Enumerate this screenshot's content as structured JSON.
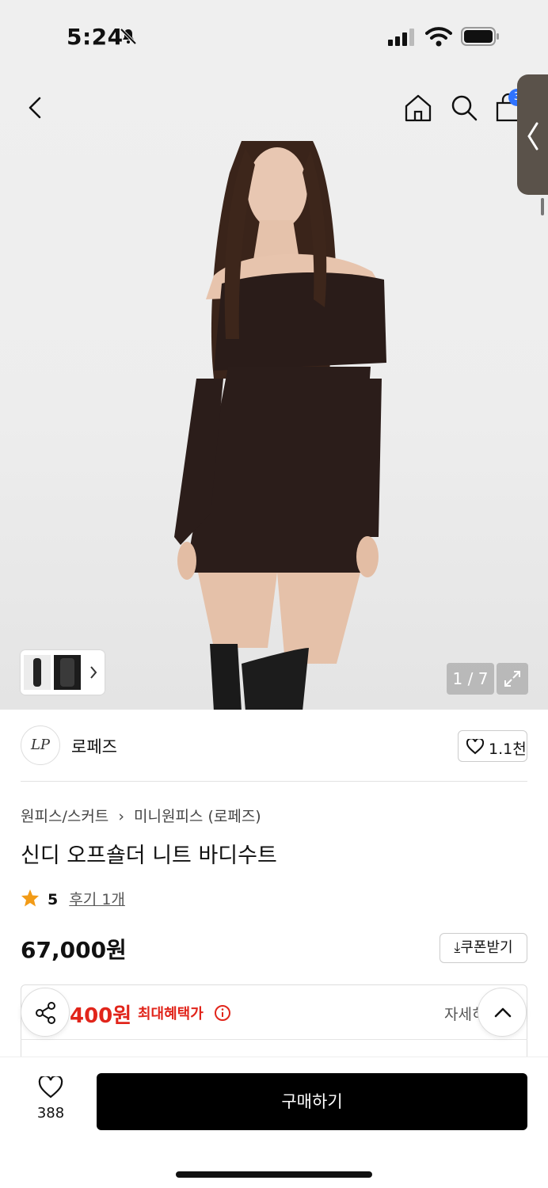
{
  "status_bar": {
    "time": "5:24"
  },
  "header": {
    "cart_count": "3"
  },
  "gallery": {
    "counter": "1 / 7"
  },
  "brand": {
    "logo_text": "LP",
    "name": "로페즈",
    "likes": "1.1천"
  },
  "product": {
    "breadcrumb": [
      "원피스/스커트",
      "미니원피스 (로페즈)"
    ],
    "title": "신디 오프숄더 니트 바디수트",
    "rating": "5",
    "reviews": "후기 1개",
    "price": "67,000원",
    "coupon_label": "쿠폰받기"
  },
  "benefit": {
    "price": "400원",
    "label": "최대혜택가",
    "detail": "자세히"
  },
  "bottom_bar": {
    "wish_count": "388",
    "buy_label": "구매하기"
  },
  "colors": {
    "accent_red": "#e1251b",
    "badge_blue": "#2f73ff",
    "buy_bg": "#000000"
  }
}
